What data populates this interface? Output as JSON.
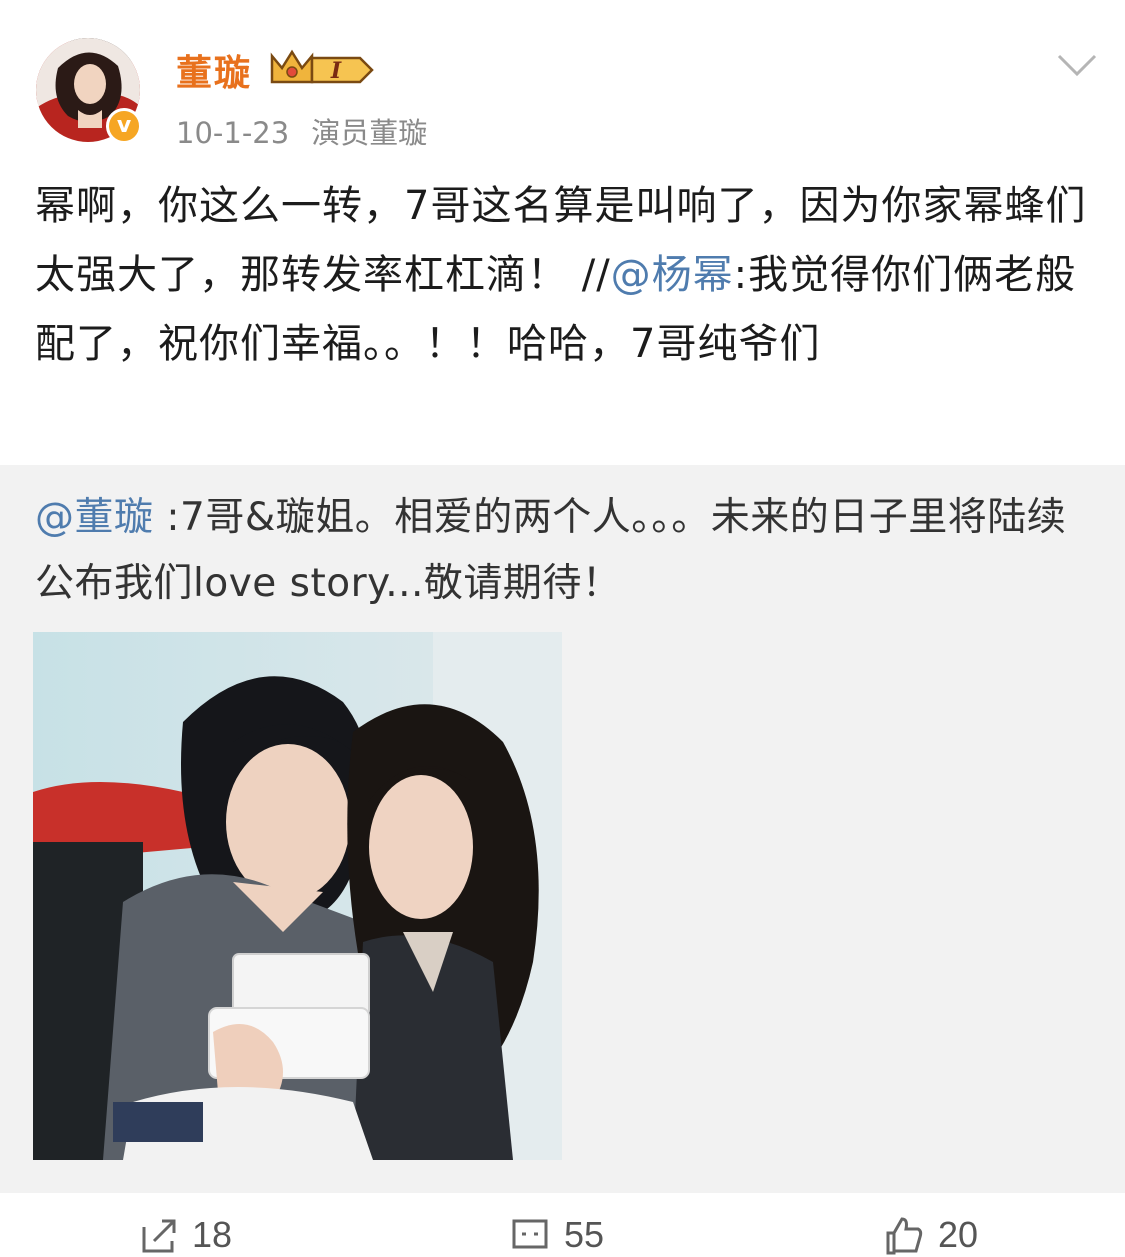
{
  "post": {
    "author": "董璇",
    "level_badge": "I",
    "timestamp": "10-1-23",
    "source": "演员董璇",
    "text_part1": "幂啊，你这么一转，7哥这名算是叫响了，因为你家幂蜂们太强大了，那转发率杠杠滴！ //",
    "mention": "@杨幂",
    "text_part2": ":我觉得你们俩老般配了，祝你们幸福。。！！哈哈，7哥纯爷们"
  },
  "repost": {
    "mention": "@董璇",
    "text": " :7哥&璇姐。相爱的两个人。。。未来的日子里将陆续公布我们love story...敬请期待！"
  },
  "actions": {
    "share_count": "18",
    "comment_count": "55",
    "like_count": "20"
  },
  "colors": {
    "username": "#e8711d",
    "mention": "#4f7cae",
    "repost_bg": "#f2f2f2"
  }
}
